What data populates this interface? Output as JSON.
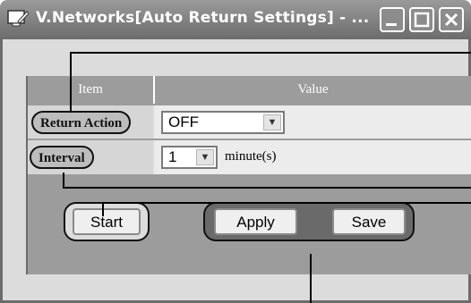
{
  "window": {
    "title": "V.Networks[Auto Return Settings] - ...",
    "colors": {
      "titlebar": "#7a7a7a",
      "body": "#dcdcdc",
      "grid": "#9c9c9c"
    }
  },
  "grid": {
    "header": {
      "item": "Item",
      "value": "Value"
    },
    "rows": [
      {
        "label": "Return Action",
        "value": "OFF"
      },
      {
        "label": "Interval",
        "value": "1",
        "unit": "minute(s)"
      }
    ]
  },
  "buttons": {
    "start": "Start",
    "apply": "Apply",
    "save": "Save"
  },
  "icons": {
    "app": "monitor-pencil-icon",
    "minimize": "minimize-icon",
    "maximize": "maximize-icon",
    "close": "close-icon",
    "dropdown": "chevron-down-icon"
  }
}
